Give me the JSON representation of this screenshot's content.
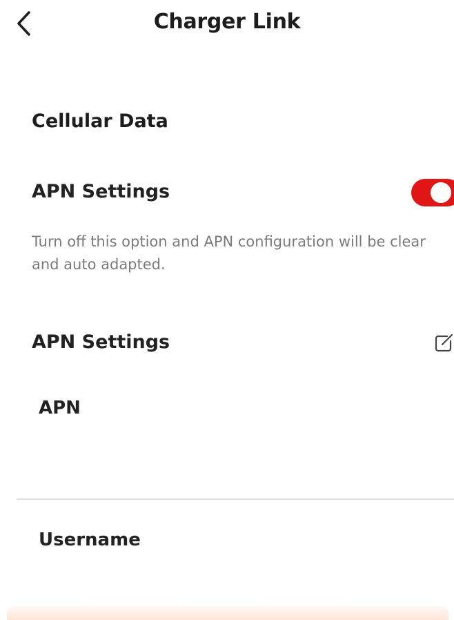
{
  "header": {
    "title": "Charger Link",
    "back_icon": "chevron-left-icon"
  },
  "cellular": {
    "section_title": "Cellular Data",
    "toggle_label": "APN Settings",
    "toggle_on": true,
    "toggle_color": "#e01616",
    "description": "Turn off this option and APN configuration will be clear and auto adapted."
  },
  "apn": {
    "heading": "APN Settings",
    "edit_icon": "edit-icon",
    "fields": {
      "apn_label": "APN",
      "apn_value": "",
      "username_label": "Username",
      "username_value": ""
    }
  }
}
